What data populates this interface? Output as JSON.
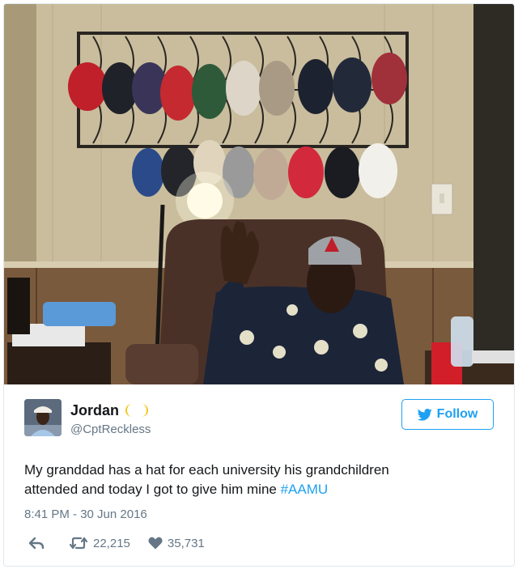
{
  "tweet": {
    "user": {
      "display_name": "Jordan",
      "name_emoji": "moon-emoji",
      "handle": "@CptReckless"
    },
    "follow_label": "Follow",
    "text_line1": "My granddad has a hat for each university his grandchildren",
    "text_line2_prefix": "attended and today I got to give him mine ",
    "hashtag": "#AAMU",
    "timestamp": "8:41 PM - 30 Jun 2016",
    "retweets": "22,215",
    "likes": "35,731",
    "accent_color": "#1da1f2",
    "text_color": "#14171a",
    "muted_color": "#657786"
  },
  "icons": {
    "reply": "reply-icon",
    "retweet": "retweet-icon",
    "like": "heart-icon",
    "follow": "bird-icon"
  }
}
